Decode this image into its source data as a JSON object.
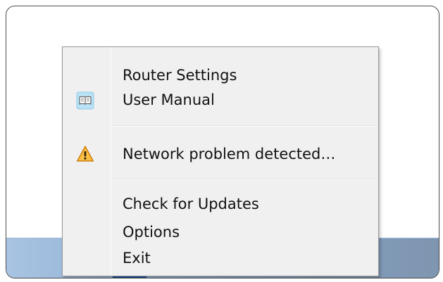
{
  "menu": {
    "groups": [
      {
        "items": [
          {
            "label": "Router Settings",
            "icon": null
          },
          {
            "label": "User Manual",
            "icon": "book-icon"
          }
        ]
      },
      {
        "items": [
          {
            "label": "Network problem detected…",
            "icon": "warning-icon"
          }
        ]
      },
      {
        "items": [
          {
            "label": "Check for Updates",
            "icon": null
          },
          {
            "label": "Options",
            "icon": null
          },
          {
            "label": "Exit",
            "icon": null
          }
        ]
      }
    ]
  },
  "colors": {
    "menu_background": "#f0f0f0",
    "warning_fill": "#f5a623",
    "book_fill": "#b9e2f5",
    "taskbar_accent": "#245eb8"
  }
}
